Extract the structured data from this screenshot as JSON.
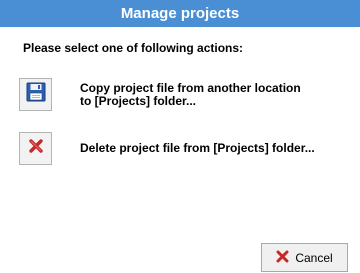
{
  "window": {
    "title": "Manage projects"
  },
  "prompt": "Please select one of following actions:",
  "actions": [
    {
      "label_line1": "Copy project file from another location",
      "label_line2": "to [Projects] folder...",
      "icon": "floppy-disk-icon"
    },
    {
      "label_line1": "Delete project file from [Projects] folder...",
      "icon": "delete-x-icon"
    }
  ],
  "footer": {
    "cancel_label": "Cancel",
    "cancel_icon": "cancel-x-icon"
  },
  "colors": {
    "title_bar": "#4a8fd4",
    "cancel_x": "#c62828",
    "delete_x": "#c62828"
  }
}
